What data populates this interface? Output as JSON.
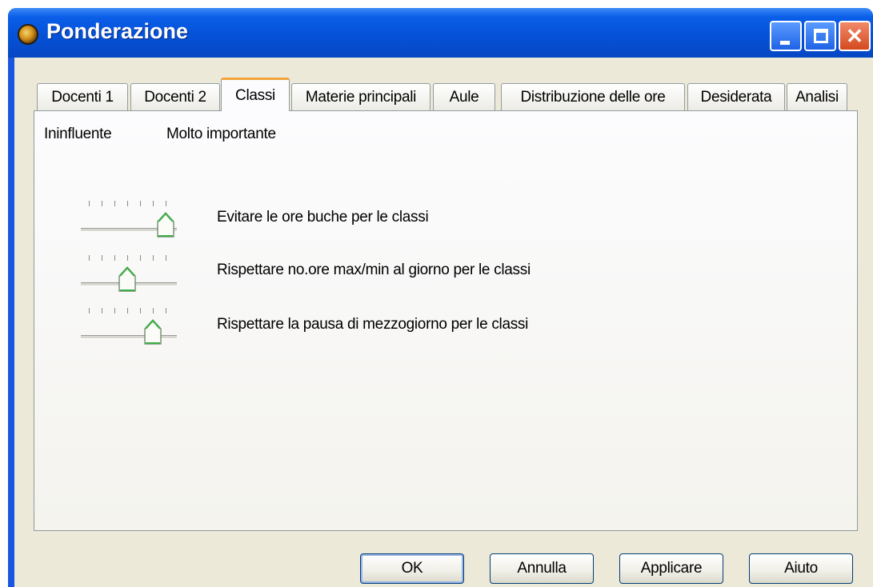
{
  "window": {
    "title": "Ponderazione"
  },
  "tabs": [
    {
      "label": "Docenti 1",
      "active": false
    },
    {
      "label": "Docenti 2",
      "active": false
    },
    {
      "label": "Classi",
      "active": true
    },
    {
      "label": "Materie principali",
      "active": false
    },
    {
      "label": "Aule",
      "active": false
    },
    {
      "label": "Distribuzione delle ore",
      "active": false
    },
    {
      "label": "Desiderata",
      "active": false
    },
    {
      "label": "Analisi",
      "active": false
    }
  ],
  "scale": {
    "low_label": "Ininfluente",
    "high_label": "Molto importante"
  },
  "sliders": [
    {
      "label": "Evitare le ore buche per le classi",
      "level": 1.0
    },
    {
      "label": "Rispettare no.ore max/min al giorno per le classi",
      "level": 0.5
    },
    {
      "label": "Rispettare la pausa di mezzogiorno per le classi",
      "level": 0.83
    }
  ],
  "buttons": {
    "ok": "OK",
    "cancel": "Annulla",
    "apply": "Applicare",
    "help": "Aiuto"
  },
  "colors": {
    "title_bar": "#0a5ee8",
    "active_tab_accent": "#f2a43a",
    "thumb_accent": "#3fae49"
  }
}
